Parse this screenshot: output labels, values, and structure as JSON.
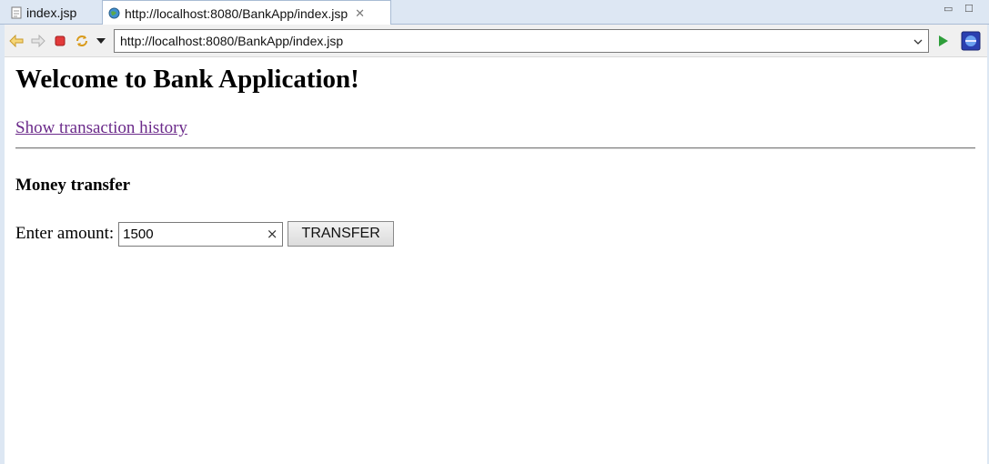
{
  "tabs": [
    {
      "label": "index.jsp",
      "icon": "jsp-file-icon"
    },
    {
      "label": "http://localhost:8080/BankApp/index.jsp",
      "icon": "globe-icon",
      "close": "✕"
    }
  ],
  "toolbar": {
    "url": "http://localhost:8080/BankApp/index.jsp",
    "icons": [
      "back-arrow-icon",
      "forward-arrow-icon",
      "stop-icon",
      "refresh-icon",
      "dropdown-icon",
      "go-icon",
      "browser-icon"
    ]
  },
  "page": {
    "heading": "Welcome to Bank Application!",
    "history_link": "Show transaction history",
    "section_title": "Money transfer",
    "amount_label": "Enter amount:",
    "amount_value": "1500",
    "clear_glyph": "×",
    "transfer_label": "TRANSFER"
  },
  "colors": {
    "link_visited": "#6b2a8a",
    "chrome_bg": "#dde7f3",
    "go_green": "#2e9e3a",
    "stop_red": "#e23a3a"
  }
}
